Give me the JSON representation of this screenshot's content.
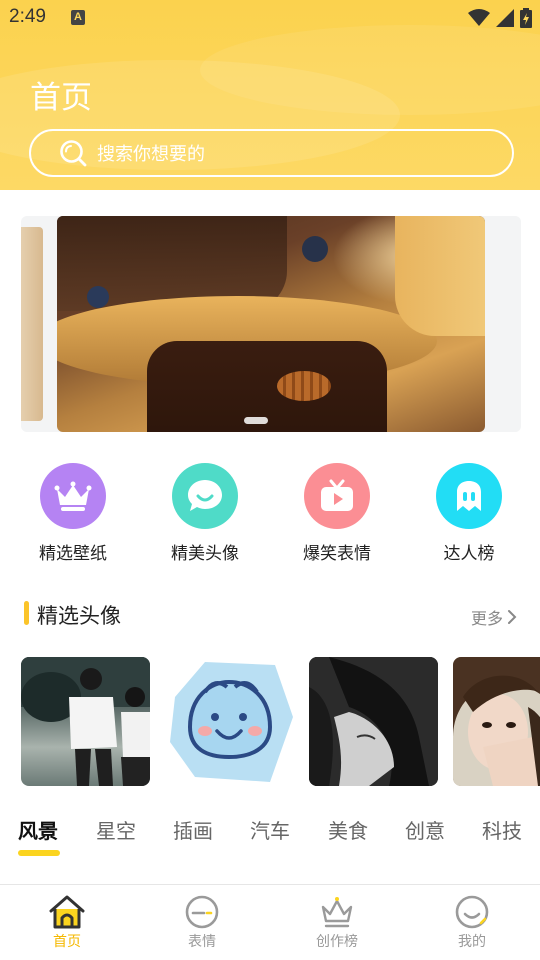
{
  "status_bar": {
    "time": "2:49",
    "notification_letter": "A"
  },
  "header": {
    "title": "首页",
    "search_placeholder": "搜索你想要的"
  },
  "banner": {
    "active_index": 1
  },
  "categories": [
    {
      "label": "精选壁纸",
      "icon": "crown-icon",
      "color": "#b583f3"
    },
    {
      "label": "精美头像",
      "icon": "chat-bubble-icon",
      "color": "#4fdbc8"
    },
    {
      "label": "爆笑表情",
      "icon": "tv-play-icon",
      "color": "#fb8e94"
    },
    {
      "label": "达人榜",
      "icon": "ghost-icon",
      "color": "#22ddf5"
    }
  ],
  "section": {
    "title": "精选头像",
    "more_label": "更多"
  },
  "tabs": [
    "风景",
    "星空",
    "插画",
    "汽车",
    "美食",
    "创意",
    "科技"
  ],
  "active_tab": "风景",
  "bottom_nav": [
    {
      "label": "首页",
      "icon": "home-icon",
      "active": true
    },
    {
      "label": "表情",
      "icon": "emoji-icon",
      "active": false
    },
    {
      "label": "创作榜",
      "icon": "crown-outline-icon",
      "active": false
    },
    {
      "label": "我的",
      "icon": "smile-icon",
      "active": false
    }
  ],
  "colors": {
    "accent": "#fbd24e",
    "active_nav": "#f5b800",
    "tab_underline": "#fbd41f"
  }
}
